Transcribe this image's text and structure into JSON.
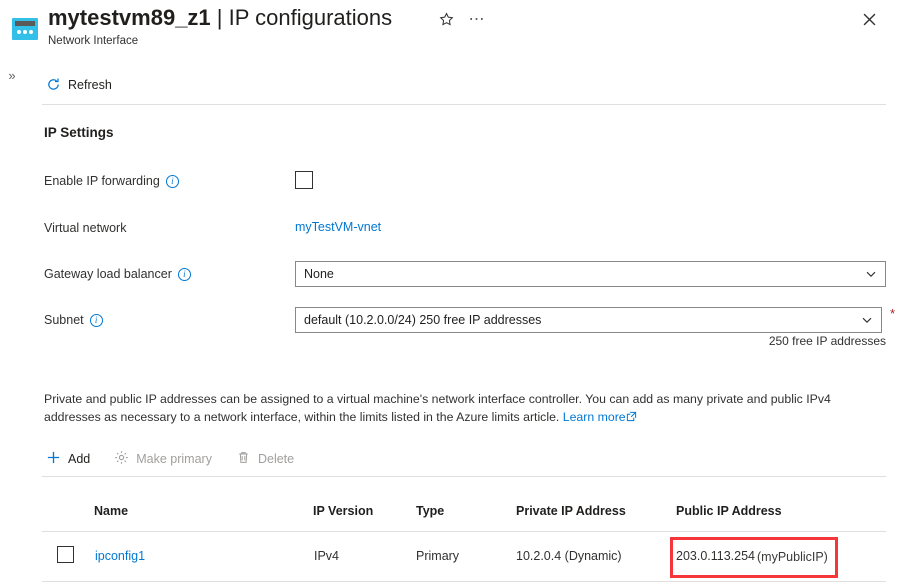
{
  "header": {
    "resource_name": "mytestvm89_z1",
    "separator": "|",
    "page_name": "IP configurations",
    "subtitle": "Network Interface",
    "icon": "network-interface-icon",
    "favorite_icon": "star-icon",
    "more_icon": "ellipsis-icon",
    "close_icon": "close-icon",
    "expand_icon": "double-chevron-right-icon"
  },
  "commandbar": {
    "refresh_label": "Refresh",
    "refresh_icon": "refresh-icon"
  },
  "settings": {
    "section_title": "IP Settings",
    "enable_ip_forwarding_label": "Enable IP forwarding",
    "enable_ip_forwarding_checked": false,
    "virtual_network_label": "Virtual network",
    "virtual_network_value": "myTestVM-vnet",
    "gateway_load_balancer_label": "Gateway load balancer",
    "gateway_load_balancer_value": "None",
    "subnet_label": "Subnet",
    "subnet_value": "default (10.2.0.0/24) 250 free IP addresses",
    "subnet_hint": "250 free IP addresses",
    "required_marker": "*",
    "info_icon": "info-icon",
    "caret_icon": "chevron-down-icon"
  },
  "description": {
    "text": "Private and public IP addresses can be assigned to a virtual machine's network interface controller. You can add as many private and public IPv4 addresses as necessary to a network interface, within the limits listed in the Azure limits article.",
    "link_label": "Learn more",
    "link_icon": "external-link-icon"
  },
  "toolbar": {
    "add_label": "Add",
    "add_icon": "plus-icon",
    "make_primary_label": "Make primary",
    "make_primary_icon": "gear-icon",
    "make_primary_disabled": true,
    "delete_label": "Delete",
    "delete_icon": "trash-icon",
    "delete_disabled": true
  },
  "table": {
    "columns": [
      "Name",
      "IP Version",
      "Type",
      "Private IP Address",
      "Public IP Address"
    ],
    "rows": [
      {
        "selected": false,
        "name": "ipconfig1",
        "ip_version": "IPv4",
        "type": "Primary",
        "private_ip": "10.2.0.4 (Dynamic)",
        "public_ip": "203.0.113.254",
        "public_ip_name": "(myPublicIP)",
        "highlighted": true
      }
    ]
  },
  "colors": {
    "accent": "#0078d4",
    "icon_cyan": "#32bfe8",
    "highlight_red": "#f5363b",
    "required_red": "#a4262c",
    "disabled_gray": "#a19f9d",
    "divider": "#e1dfdd"
  }
}
